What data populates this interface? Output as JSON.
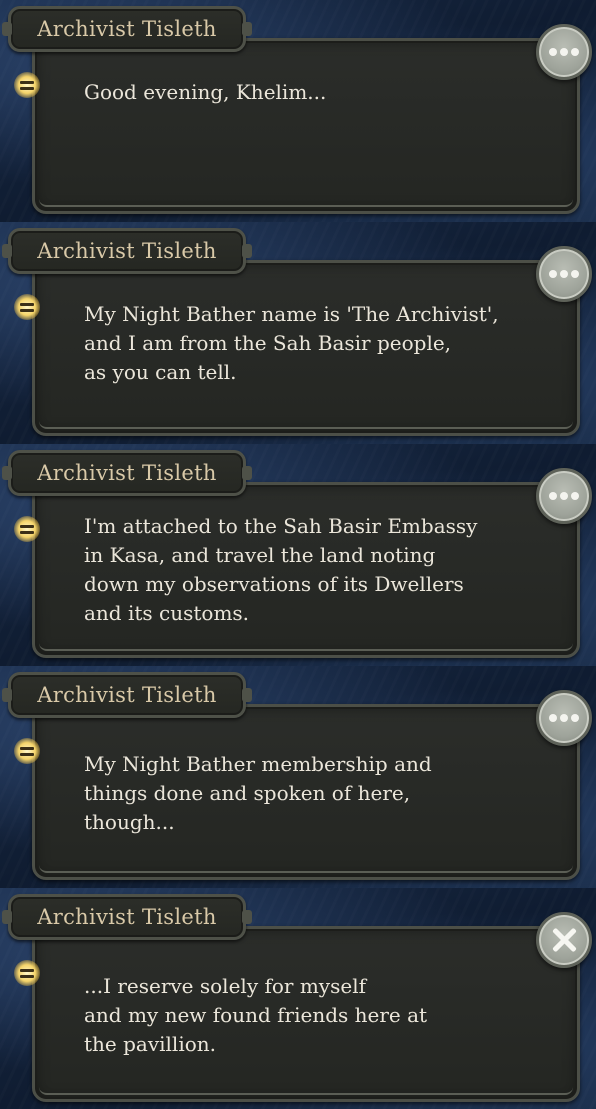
{
  "dialogs": [
    {
      "speaker": "Archivist Tisleth",
      "lines": [
        "Good evening, Khelim..."
      ],
      "action": "more",
      "action_icon": "ellipsis-icon"
    },
    {
      "speaker": "Archivist Tisleth",
      "lines": [
        "My Night Bather name is 'The Archivist',",
        "and I am from the Sah Basir people,",
        "as you can tell."
      ],
      "action": "more",
      "action_icon": "ellipsis-icon"
    },
    {
      "speaker": "Archivist Tisleth",
      "lines": [
        "I'm attached to the Sah Basir Embassy",
        "in Kasa, and travel the land noting",
        "down my observations of its Dwellers",
        "and its customs."
      ],
      "action": "more",
      "action_icon": "ellipsis-icon"
    },
    {
      "speaker": "Archivist Tisleth",
      "lines": [
        "My Night Bather membership and",
        "things done and spoken of here,",
        "though..."
      ],
      "action": "more",
      "action_icon": "ellipsis-icon"
    },
    {
      "speaker": "Archivist Tisleth",
      "lines": [
        "...I reserve solely for myself",
        "and my new found friends here at",
        "the pavillion."
      ],
      "action": "close",
      "action_icon": "close-icon"
    }
  ],
  "colors": {
    "speaker_text": "#d9c9a8",
    "dialogue_text": "#ebe6da",
    "panel_fill": "#2b2d2a",
    "panel_border": "#4c4f47",
    "button_fill": "#9ea39a",
    "lamp_glow": "#f5d46a"
  }
}
